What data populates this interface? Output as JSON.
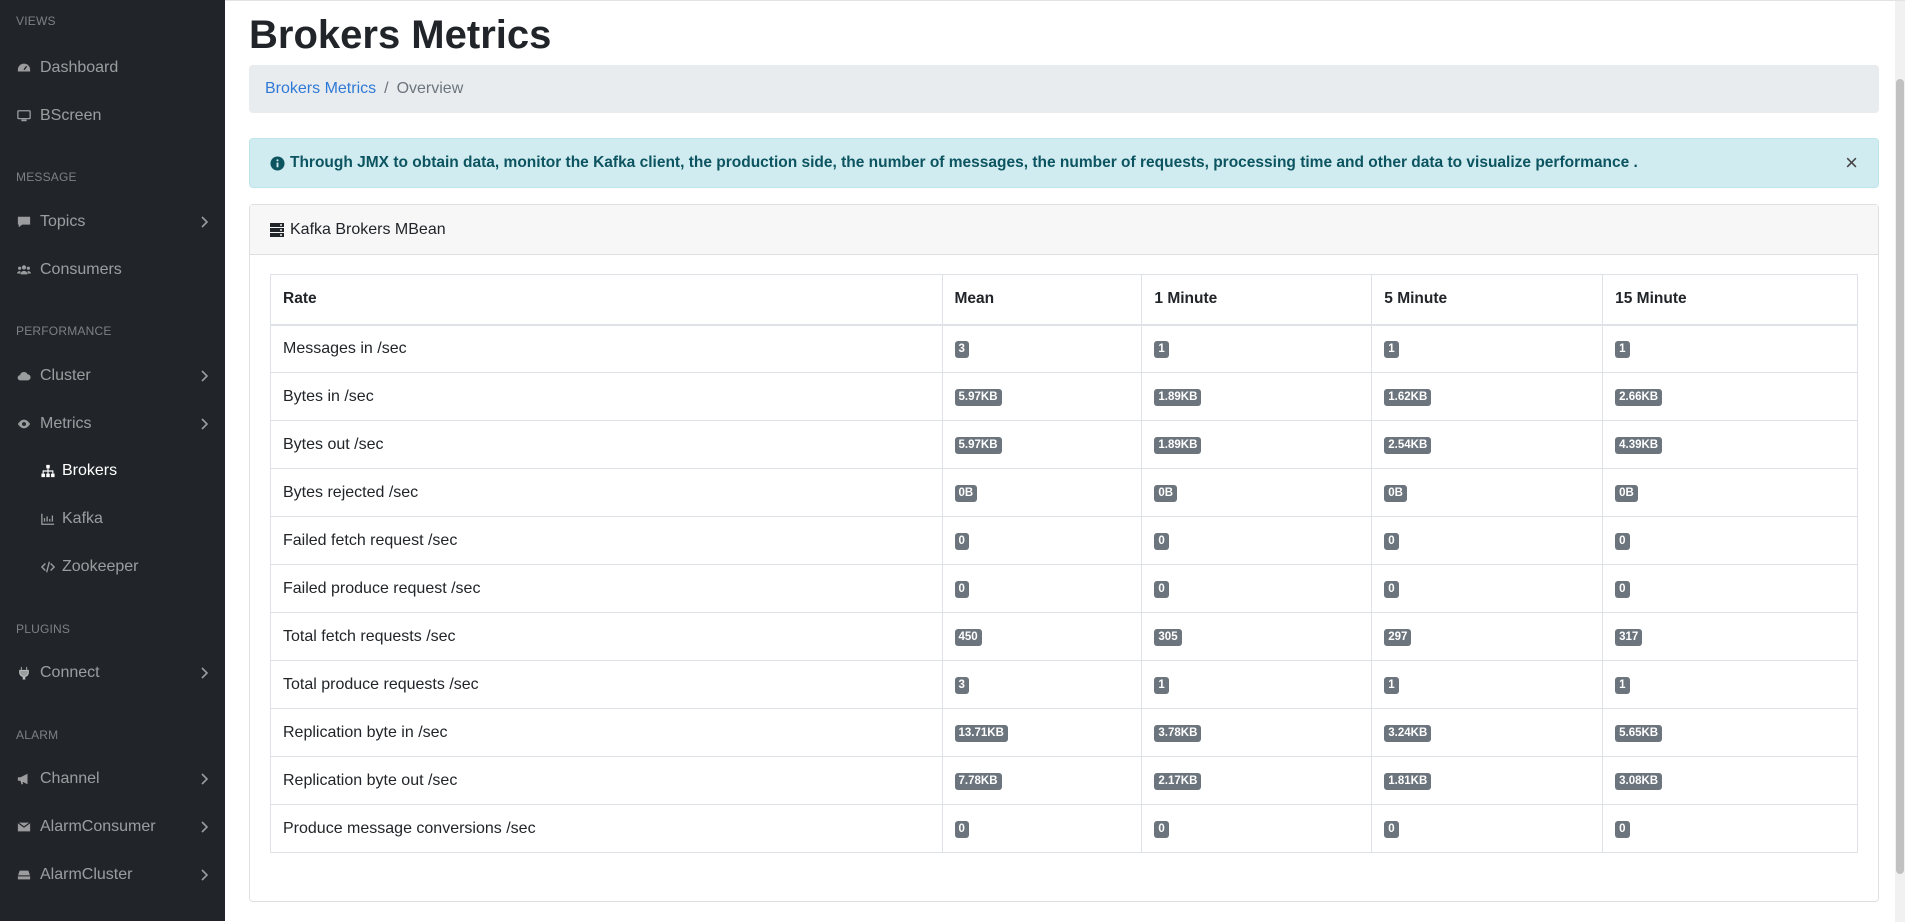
{
  "sidebar": {
    "views_heading": "VIEWS",
    "message_heading": "MESSAGE",
    "performance_heading": "PERFORMANCE",
    "plugins_heading": "PLUGINS",
    "alarm_heading": "ALARM",
    "dashboard": "Dashboard",
    "bscreen": "BScreen",
    "topics": "Topics",
    "consumers": "Consumers",
    "cluster": "Cluster",
    "metrics": "Metrics",
    "brokers": "Brokers",
    "kafka": "Kafka",
    "zookeeper": "Zookeeper",
    "connect": "Connect",
    "channel": "Channel",
    "alarm_consumer": "AlarmConsumer",
    "alarm_cluster": "AlarmCluster"
  },
  "page": {
    "title": "Brokers Metrics"
  },
  "breadcrumb": {
    "link": "Brokers Metrics",
    "separator": "/",
    "active": "Overview"
  },
  "alert": {
    "text": "Through JMX to obtain data, monitor the Kafka client, the production side, the number of messages, the number of requests, processing time and other data to visualize performance .",
    "close": "×"
  },
  "card": {
    "title": "Kafka Brokers MBean"
  },
  "table": {
    "headers": [
      "Rate",
      "Mean",
      "1 Minute",
      "5 Minute",
      "15 Minute"
    ],
    "rows": [
      [
        "Messages in /sec",
        "3",
        "1",
        "1",
        "1"
      ],
      [
        "Bytes in /sec",
        "5.97KB",
        "1.89KB",
        "1.62KB",
        "2.66KB"
      ],
      [
        "Bytes out /sec",
        "5.97KB",
        "1.89KB",
        "2.54KB",
        "4.39KB"
      ],
      [
        "Bytes rejected /sec",
        "0B",
        "0B",
        "0B",
        "0B"
      ],
      [
        "Failed fetch request /sec",
        "0",
        "0",
        "0",
        "0"
      ],
      [
        "Failed produce request /sec",
        "0",
        "0",
        "0",
        "0"
      ],
      [
        "Total fetch requests /sec",
        "450",
        "305",
        "297",
        "317"
      ],
      [
        "Total produce requests /sec",
        "3",
        "1",
        "1",
        "1"
      ],
      [
        "Replication byte in /sec",
        "13.71KB",
        "3.78KB",
        "3.24KB",
        "5.65KB"
      ],
      [
        "Replication byte out /sec",
        "7.78KB",
        "2.17KB",
        "1.81KB",
        "3.08KB"
      ],
      [
        "Produce message conversions /sec",
        "0",
        "0",
        "0",
        "0"
      ]
    ]
  },
  "colors": {
    "sidebar_bg": "#212529",
    "link": "#2f7ad6",
    "alert_bg": "#d1ecf1",
    "alert_text": "#0c5460",
    "badge_bg": "#6c757d"
  }
}
